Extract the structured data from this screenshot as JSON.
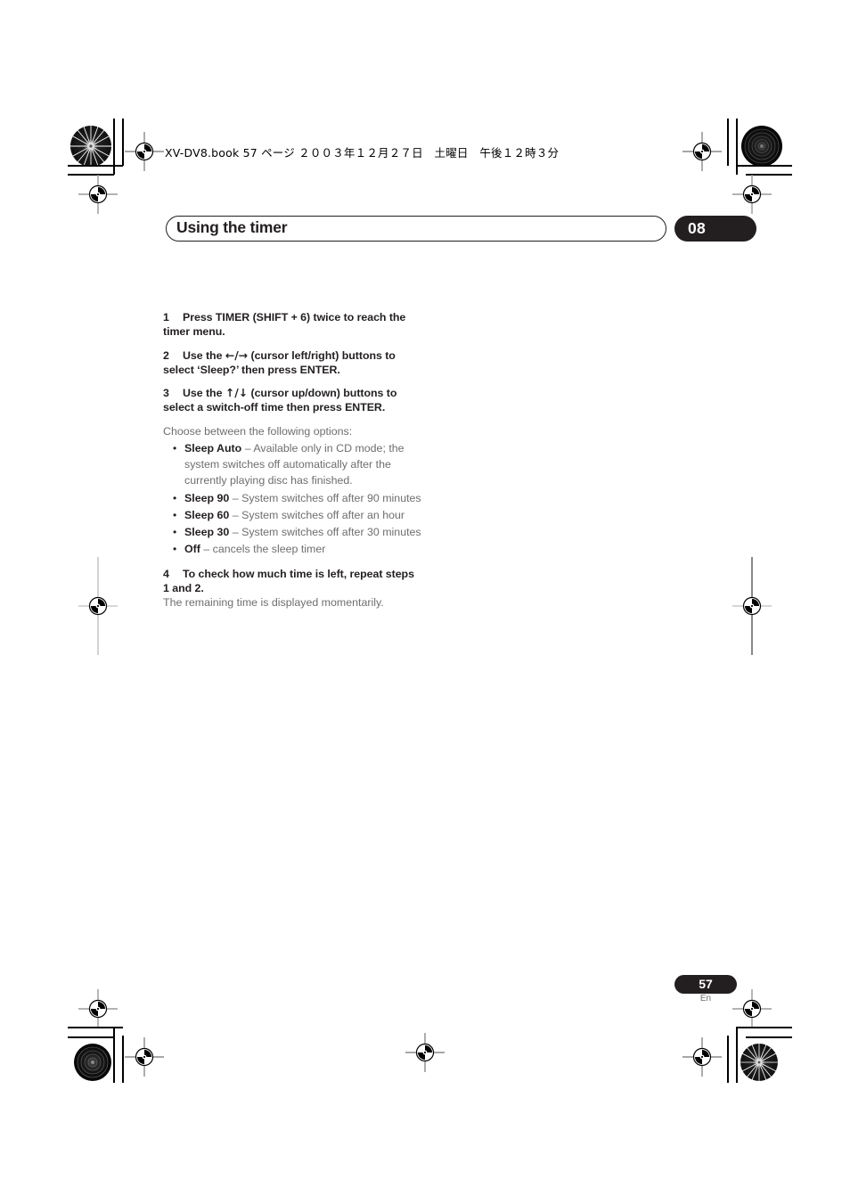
{
  "page": {
    "header_line": "XV-DV8.book 57 ページ ２００３年１２月２７日　土曜日　午後１２時３分",
    "chapter_title": "Using the timer",
    "chapter_number": "08",
    "page_number": "57",
    "language_code": "En",
    "colors": {
      "ink": "#231f20",
      "body_gray": "#6e6e6e",
      "paper": "#ffffff"
    }
  },
  "steps": [
    {
      "number": "1",
      "text": "Press TIMER (SHIFT + 6) twice to reach the timer menu."
    },
    {
      "number": "2",
      "text_before": "Use the ",
      "arrows": "←/→",
      "text_after": " (cursor left/right) buttons to select ‘Sleep?’ then press ENTER."
    },
    {
      "number": "3",
      "text_before": "Use the ",
      "arrows": "↑/↓",
      "text_after": " (cursor up/down) buttons to select a switch-off time then press ENTER."
    },
    {
      "number": "4",
      "text": "To check how much time is left, repeat steps 1 and 2."
    }
  ],
  "intro_line": "Choose between the following options:",
  "options": [
    {
      "label": "Sleep Auto",
      "description": " – Available only in CD mode; the system switches off automatically after the currently playing disc has finished."
    },
    {
      "label": "Sleep 90",
      "description": " – System switches off after 90 minutes"
    },
    {
      "label": "Sleep 60",
      "description": " – System switches off after an hour"
    },
    {
      "label": "Sleep 30",
      "description": " – System switches off after 30 minutes"
    },
    {
      "label": "Off",
      "description": " – cancels the sleep timer"
    }
  ],
  "closing_line": "The remaining time is displayed momentarily."
}
